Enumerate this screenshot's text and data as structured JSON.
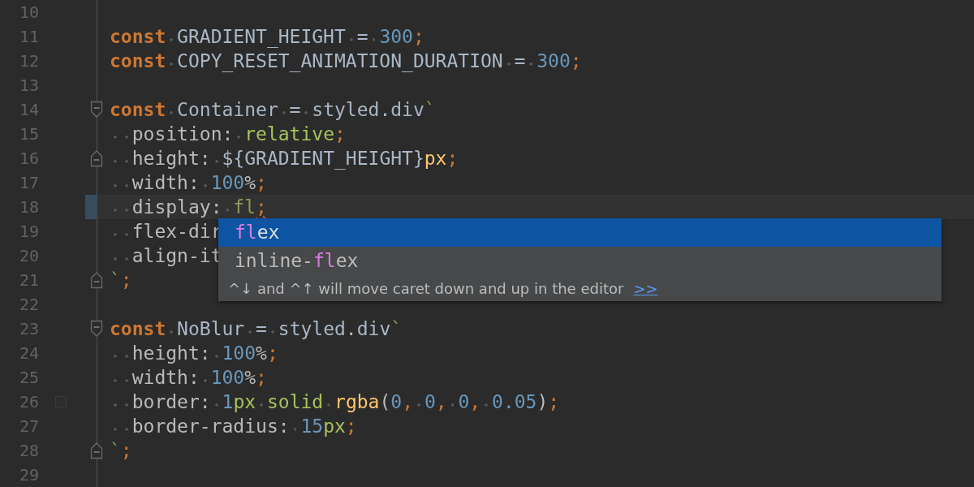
{
  "editor": {
    "lines": [
      {
        "number": "10"
      },
      {
        "number": "11",
        "tokens": [
          {
            "kind": "keyword",
            "text": "const"
          },
          {
            "kind": "identifier",
            "text": " GRADIENT_HEIGHT = "
          },
          {
            "kind": "number",
            "text": "300"
          },
          {
            "kind": "punct",
            "text": ";"
          }
        ]
      },
      {
        "number": "12",
        "tokens": [
          {
            "kind": "keyword",
            "text": "const"
          },
          {
            "kind": "identifier",
            "text": " COPY_RESET_ANIMATION_DURATION = "
          },
          {
            "kind": "number",
            "text": "300"
          },
          {
            "kind": "punct",
            "text": ";"
          }
        ]
      },
      {
        "number": "13"
      },
      {
        "number": "14",
        "kind": "fold-start",
        "tokens": [
          {
            "kind": "keyword",
            "text": "const"
          },
          {
            "kind": "identifier",
            "text": " Container = styled.div"
          },
          {
            "kind": "string",
            "text": "`"
          }
        ]
      },
      {
        "number": "15",
        "tokens": [
          {
            "kind": "property",
            "text": "  position: "
          },
          {
            "kind": "value",
            "text": "relative"
          },
          {
            "kind": "punct",
            "text": ";"
          }
        ]
      },
      {
        "number": "16",
        "kind": "fold-end",
        "tokens": [
          {
            "kind": "property",
            "text": "  height: "
          },
          {
            "kind": "identifier",
            "text": "${GRADIENT_HEIGHT}"
          },
          {
            "kind": "function",
            "text": "px"
          },
          {
            "kind": "punct",
            "text": ";"
          }
        ]
      },
      {
        "number": "17",
        "tokens": [
          {
            "kind": "property",
            "text": "  width: "
          },
          {
            "kind": "number",
            "text": "100"
          },
          {
            "kind": "property",
            "text": "%"
          },
          {
            "kind": "punct",
            "text": ";"
          }
        ]
      },
      {
        "number": "18",
        "current": true,
        "modified": true,
        "tokens": [
          {
            "kind": "property",
            "text": "  display: "
          },
          {
            "kind": "string",
            "text": "fl"
          },
          {
            "kind": "punct",
            "text": ";",
            "error": true
          }
        ]
      },
      {
        "number": "19",
        "tokens": [
          {
            "kind": "property",
            "text": "  flex-dir"
          }
        ]
      },
      {
        "number": "20",
        "tokens": [
          {
            "kind": "property",
            "text": "  align-it"
          }
        ]
      },
      {
        "number": "21",
        "kind": "fold-end",
        "tokens": [
          {
            "kind": "string",
            "text": "`"
          },
          {
            "kind": "punct",
            "text": ";"
          }
        ]
      },
      {
        "number": "22"
      },
      {
        "number": "23",
        "kind": "fold-start",
        "tokens": [
          {
            "kind": "keyword",
            "text": "const"
          },
          {
            "kind": "identifier",
            "text": " NoBlur = styled.div"
          },
          {
            "kind": "string",
            "text": "`"
          }
        ]
      },
      {
        "number": "24",
        "tokens": [
          {
            "kind": "property",
            "text": "  height: "
          },
          {
            "kind": "number",
            "text": "100"
          },
          {
            "kind": "property",
            "text": "%"
          },
          {
            "kind": "punct",
            "text": ";"
          }
        ]
      },
      {
        "number": "25",
        "tokens": [
          {
            "kind": "property",
            "text": "  width: "
          },
          {
            "kind": "number",
            "text": "100"
          },
          {
            "kind": "property",
            "text": "%"
          },
          {
            "kind": "punct",
            "text": ";"
          }
        ]
      },
      {
        "number": "26",
        "kind": "square",
        "tokens": [
          {
            "kind": "property",
            "text": "  border: "
          },
          {
            "kind": "number",
            "text": "1"
          },
          {
            "kind": "value",
            "text": "px solid "
          },
          {
            "kind": "function",
            "text": "rgba"
          },
          {
            "kind": "property",
            "text": "("
          },
          {
            "kind": "number",
            "text": "0"
          },
          {
            "kind": "punct",
            "text": ", "
          },
          {
            "kind": "number",
            "text": "0"
          },
          {
            "kind": "punct",
            "text": ", "
          },
          {
            "kind": "number",
            "text": "0"
          },
          {
            "kind": "punct",
            "text": ", "
          },
          {
            "kind": "number",
            "text": "0.05"
          },
          {
            "kind": "property",
            "text": ")"
          },
          {
            "kind": "punct",
            "text": ";"
          }
        ]
      },
      {
        "number": "27",
        "tokens": [
          {
            "kind": "property",
            "text": "  border-radius: "
          },
          {
            "kind": "number",
            "text": "15"
          },
          {
            "kind": "value",
            "text": "px"
          },
          {
            "kind": "punct",
            "text": ";"
          }
        ]
      },
      {
        "number": "28",
        "kind": "fold-end",
        "tokens": [
          {
            "kind": "string",
            "text": "`"
          },
          {
            "kind": "punct",
            "text": ";"
          }
        ]
      },
      {
        "number": "29"
      }
    ]
  },
  "completion": {
    "items": [
      {
        "selected": true,
        "match": "fl",
        "after": "ex"
      },
      {
        "selected": false,
        "before": "inline-",
        "match": "fl",
        "after": "ex"
      }
    ],
    "hint": "^↓ and ^↑ will move caret down and up in the editor",
    "hint_link": ">>"
  }
}
